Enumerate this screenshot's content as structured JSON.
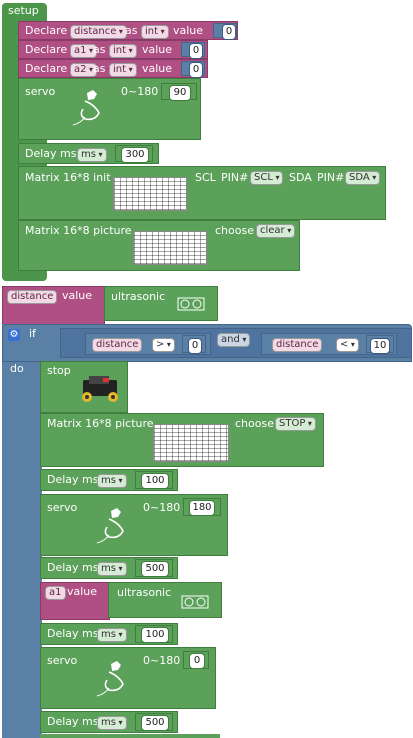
{
  "setup": {
    "label": "setup",
    "declares": [
      {
        "keyword": "Declare",
        "var": "distance",
        "as": "as",
        "type": "int",
        "value_label": "value",
        "value": "0"
      },
      {
        "keyword": "Declare",
        "var": "a1",
        "as": "as",
        "type": "int",
        "value_label": "value",
        "value": "0"
      },
      {
        "keyword": "Declare",
        "var": "a2",
        "as": "as",
        "type": "int",
        "value_label": "value",
        "value": "0"
      }
    ],
    "servo": {
      "label": "servo",
      "range": "0~180",
      "value": "90"
    },
    "delay": {
      "label": "Delay ms",
      "unit": "ms",
      "value": "300"
    },
    "matrix_init": {
      "label": "Matrix 16*8 init",
      "scl_label": "SCL",
      "pin_label": "PIN#",
      "scl_pin": "SCL",
      "sda_label": "SDA",
      "sda_pin": "SDA"
    },
    "matrix_picture": {
      "label": "Matrix 16*8 picture",
      "choose_label": "choose",
      "choice": "clear"
    }
  },
  "assign": {
    "var": "distance",
    "value_label": "value",
    "sensor": "ultrasonic"
  },
  "if_block": {
    "if_label": "if",
    "do_label": "do",
    "cond_left": {
      "var": "distance",
      "op": ">",
      "value": "0"
    },
    "logic": "and",
    "cond_right": {
      "var": "distance",
      "op": "<",
      "value": "10"
    }
  },
  "do": {
    "stop": {
      "label": "stop"
    },
    "matrix_picture": {
      "label": "Matrix 16*8 picture",
      "choose_label": "choose",
      "choice": "STOP"
    },
    "delay1": {
      "label": "Delay ms",
      "unit": "ms",
      "value": "100"
    },
    "servo1": {
      "label": "servo",
      "range": "0~180",
      "value": "180"
    },
    "delay2": {
      "label": "Delay ms",
      "unit": "ms",
      "value": "500"
    },
    "assign_a1": {
      "var": "a1",
      "value_label": "value",
      "sensor": "ultrasonic"
    },
    "delay3": {
      "label": "Delay ms",
      "unit": "ms",
      "value": "100"
    },
    "servo2": {
      "label": "servo",
      "range": "0~180",
      "value": "0"
    },
    "delay4": {
      "label": "Delay ms",
      "unit": "ms",
      "value": "500"
    }
  },
  "colors": {
    "green": "#5ba15a",
    "purple": "#b04f83",
    "blue": "#5b80a5"
  }
}
